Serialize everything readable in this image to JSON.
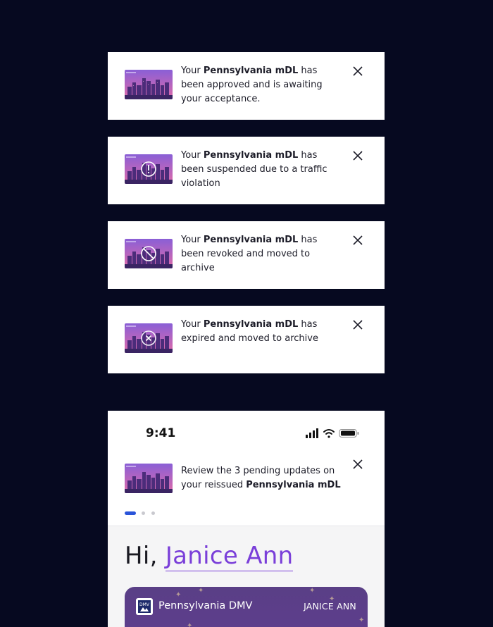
{
  "notifications": [
    {
      "prefix": "Your ",
      "credential": "Pennsylvania mDL",
      "suffix": " has been approved and is awaiting your acceptance.",
      "overlay_icon": "none"
    },
    {
      "prefix": "Your ",
      "credential": "Pennsylvania mDL",
      "suffix": " has been suspended due to a traffic violation",
      "overlay_icon": "exclamation-circle-icon"
    },
    {
      "prefix": "Your ",
      "credential": "Pennsylvania mDL",
      "suffix": " has been revoked and moved to archive",
      "overlay_icon": "prohibited-icon"
    },
    {
      "prefix": "Your ",
      "credential": "Pennsylvania mDL",
      "suffix": " has expired and moved to archive",
      "overlay_icon": "x-circle-icon"
    }
  ],
  "phone": {
    "status_time": "9:41",
    "banner": {
      "prefix": "Review the 3 pending updates on your reissued ",
      "credential": "Pennsylvania mDL"
    },
    "pager": {
      "count": 3,
      "active_index": 0
    },
    "greeting_prefix": "Hi, ",
    "user_name": "Janice Ann",
    "credential_card": {
      "issuer": "Pennsylvania DMV",
      "holder": "JANICE ANN",
      "logo_text": "DMV"
    }
  },
  "colors": {
    "background": "#060920",
    "accent_purple": "#7a3fd9",
    "pager_active": "#2a54d9"
  }
}
